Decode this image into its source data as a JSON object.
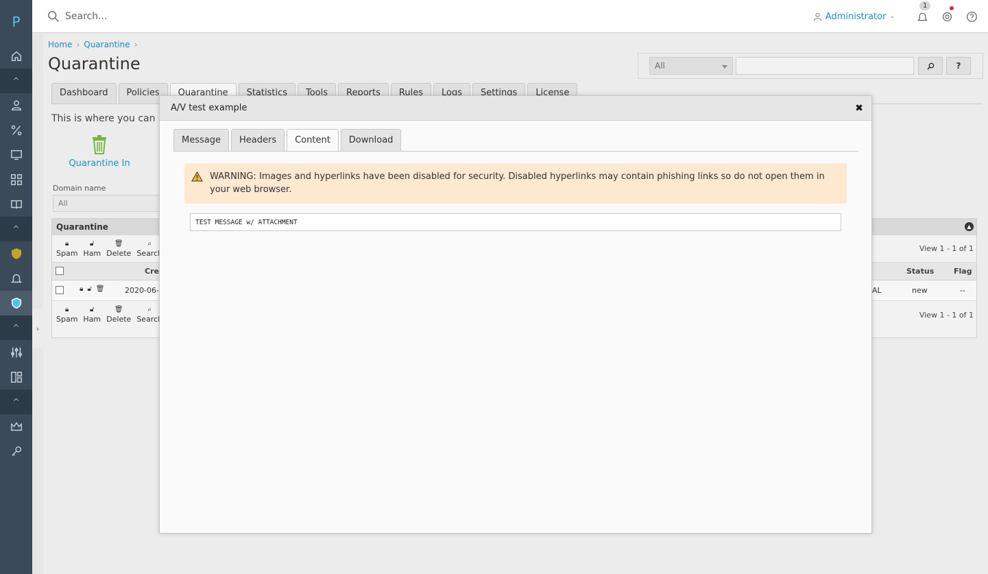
{
  "rail": {
    "logo": "P",
    "items": [
      "home-icon",
      "collapse-icon",
      "user-icon",
      "percent-icon",
      "monitor-icon",
      "grid-icon",
      "book-icon",
      "collapse-icon",
      "shield-icon",
      "bell-icon",
      "quarantine-icon",
      "collapse-icon",
      "sliders-icon",
      "layout-icon",
      "collapse-icon",
      "crown-icon",
      "key-icon"
    ]
  },
  "topbar": {
    "search_placeholder": "Search...",
    "user": "Administrator",
    "notif_count": "1"
  },
  "breadcrumb": {
    "home": "Home",
    "quarantine": "Quarantine"
  },
  "page_title": "Quarantine",
  "main_tabs": [
    "Dashboard",
    "Policies",
    "Quarantine",
    "Statistics",
    "Tools",
    "Reports",
    "Rules",
    "Logs",
    "Settings",
    "License"
  ],
  "intro_text": "This is where you can m",
  "quarantine_in_label": "Quarantine In",
  "domain": {
    "label": "Domain name",
    "value": "All"
  },
  "filter": {
    "select_value": "All",
    "help_label": "?"
  },
  "grid": {
    "title": "Quarantine",
    "tools": [
      "Spam",
      "Ham",
      "Delete",
      "Search"
    ],
    "view_text": "View 1 - 1 of 1",
    "col_created": "Crea",
    "col_status": "Status",
    "col_flag": "Flag",
    "row": {
      "date": "2020-06-1",
      "al": "AL",
      "status": "new",
      "flag": "--"
    }
  },
  "modal": {
    "title": "A/V test example",
    "tabs": [
      "Message",
      "Headers",
      "Content",
      "Download"
    ],
    "selected_tab": "Content",
    "warning": "WARNING: Images and hyperlinks have been disabled for security. Disabled hyperlinks may contain phishing links so do not open them in your web browser.",
    "content_text": "TEST MESSAGE w/ ATTACHMENT"
  }
}
